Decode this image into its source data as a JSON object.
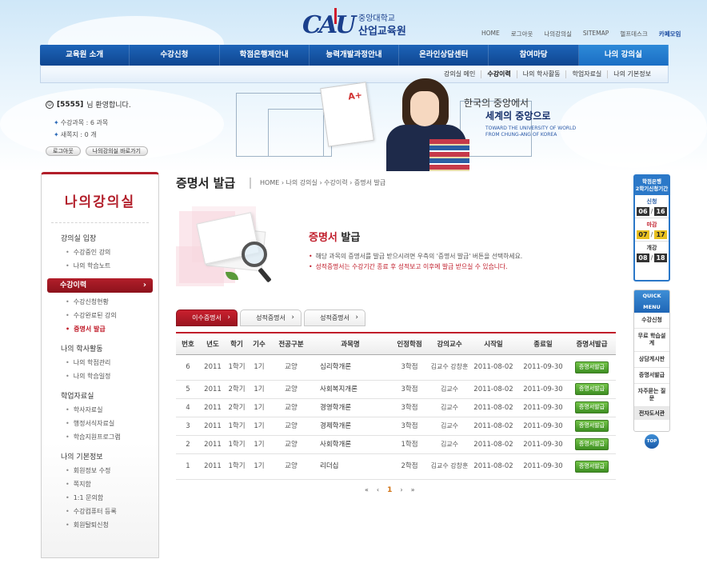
{
  "header": {
    "logo_mark": "CAU",
    "logo_line1": "중앙대학교",
    "logo_line2": "산업교육원",
    "top_links": [
      "HOME",
      "로그아웃",
      "나의강의실",
      "SITEMAP",
      "헬프데스크",
      "카페모임"
    ]
  },
  "gnb": {
    "items": [
      "교육원 소개",
      "수강신청",
      "학점은행제안내",
      "능력개발과정안내",
      "온라인상담센터",
      "참여마당",
      "나의 강의실"
    ],
    "active_index": 6
  },
  "lnb": {
    "items": [
      "강의실 메인",
      "수강이력",
      "나의 학사활동",
      "학업자료실",
      "나의 기본정보"
    ],
    "active_index": 1
  },
  "welcome": {
    "user": "[5555]",
    "greeting": "님 환영합니다.",
    "courses": "수강과목 : 6 과목",
    "messages": "새쪽지 : 0 개",
    "logout_button": "로그아웃",
    "shortcut_button": "나의강의실 바로가기"
  },
  "hero": {
    "slogan_line1": "한국의 중앙에서",
    "slogan_line2": "세계의 중앙으로",
    "slogan_en1": "TOWARD THE UNIVERSITY OF WORLD",
    "slogan_en2": "FROM CHUNG-ANG OF KOREA"
  },
  "sidebar": {
    "title": "나의강의실",
    "groups": [
      {
        "label": "강의실 입장",
        "items": [
          "수강중인 강의",
          "나의 학습노트"
        ]
      },
      {
        "label": "수강이력",
        "items": [
          "수강신청현황",
          "수강완료된 강의",
          "증명서 발급"
        ]
      },
      {
        "label": "나의 학사활동",
        "items": [
          "나의 학점관리",
          "나의 학습일정"
        ]
      },
      {
        "label": "학업자료실",
        "items": [
          "학사자료실",
          "행정서식자료실",
          "학습지원프로그램"
        ]
      },
      {
        "label": "나의 기본정보",
        "items": [
          "회원정보 수정",
          "쪽지함",
          "1:1 문의함",
          "수강컴퓨터 등록",
          "회원탈퇴신청"
        ]
      }
    ]
  },
  "page": {
    "title": "증명서 발급",
    "breadcrumb": "HOME › 나의 강의실 › 수강이력 › 증명서 발급",
    "intro_title_colored": "증명서",
    "intro_title_rest": " 발급",
    "desc1": "해당 과목의 증명서를 발급 받으시려면 우측의 '증명서 발급' 버튼을 선택하세요.",
    "desc2": "성적증명서는 수강기간 종료 후 성적보고 이후에 발급 받으실 수 있습니다."
  },
  "tabs": [
    "이수증명서",
    "성적증명서",
    "성적증명서"
  ],
  "table": {
    "headers": [
      "번호",
      "년도",
      "학기",
      "기수",
      "전공구분",
      "과목명",
      "인정학점",
      "강의교수",
      "시작일",
      "종료일",
      "증명서발급"
    ],
    "rows": [
      {
        "no": "6",
        "year": "2011",
        "sem": "1학기",
        "term": "1기",
        "major": "교양",
        "subject": "심리학개론",
        "credit": "3학점",
        "prof": "김교수 강창훈",
        "start": "2011-08-02",
        "end": "2011-09-30",
        "btn": "증명서발급"
      },
      {
        "no": "5",
        "year": "2011",
        "sem": "2학기",
        "term": "1기",
        "major": "교양",
        "subject": "사회복지개론",
        "credit": "3학점",
        "prof": "김교수",
        "start": "2011-08-02",
        "end": "2011-09-30",
        "btn": "증명서발급"
      },
      {
        "no": "4",
        "year": "2011",
        "sem": "2학기",
        "term": "1기",
        "major": "교양",
        "subject": "경영학개론",
        "credit": "3학점",
        "prof": "김교수",
        "start": "2011-08-02",
        "end": "2011-09-30",
        "btn": "증명서발급"
      },
      {
        "no": "3",
        "year": "2011",
        "sem": "1학기",
        "term": "1기",
        "major": "교양",
        "subject": "경제학개론",
        "credit": "3학점",
        "prof": "김교수",
        "start": "2011-08-02",
        "end": "2011-09-30",
        "btn": "증명서발급"
      },
      {
        "no": "2",
        "year": "2011",
        "sem": "1학기",
        "term": "1기",
        "major": "교양",
        "subject": "사회학개론",
        "credit": "1학점",
        "prof": "김교수",
        "start": "2011-08-02",
        "end": "2011-09-30",
        "btn": "증명서발급"
      },
      {
        "no": "1",
        "year": "2011",
        "sem": "1학기",
        "term": "1기",
        "major": "교양",
        "subject": "리더십",
        "credit": "2학점",
        "prof": "김교수 강창훈",
        "start": "2011-08-02",
        "end": "2011-09-30",
        "btn": "증명서발급"
      }
    ]
  },
  "pager": {
    "first": "«",
    "prev": "‹",
    "current": "1",
    "next": "›",
    "last": "»"
  },
  "right_schedule": {
    "title1": "학점은행",
    "title2": "2학기신청기간",
    "blocks": [
      {
        "label": "신청",
        "m": "06",
        "d": "16"
      },
      {
        "label": "마감",
        "m": "07",
        "d": "17"
      },
      {
        "label": "개강",
        "m": "08",
        "d": "18"
      }
    ]
  },
  "quick_menu": {
    "title": "QUICK MENU",
    "items": [
      "수강신청",
      "무료 학습설계",
      "상담게시판",
      "증명서발급",
      "자주묻는 질문"
    ],
    "footer": "전자도서관",
    "top": "TOP"
  },
  "colors": {
    "brand_blue": "#1a4aa0",
    "accent_red": "#b21e2a",
    "green_button": "#4ea12e"
  }
}
